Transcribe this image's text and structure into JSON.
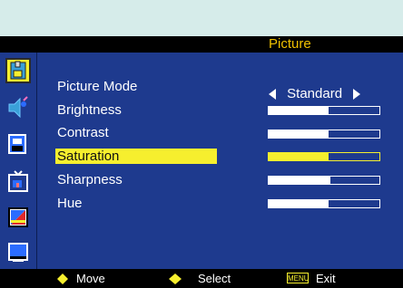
{
  "window": {
    "title": "Picture"
  },
  "menu": {
    "items": [
      {
        "label": "Picture Mode",
        "type": "selector",
        "value": "Standard"
      },
      {
        "label": "Brightness",
        "type": "slider",
        "level": 0.54
      },
      {
        "label": "Contrast",
        "type": "slider",
        "level": 0.54
      },
      {
        "label": "Saturation",
        "type": "slider",
        "level": 0.54,
        "selected": true
      },
      {
        "label": "Sharpness",
        "type": "slider",
        "level": 0.56
      },
      {
        "label": "Hue",
        "type": "slider",
        "level": 0.54
      }
    ]
  },
  "sidebar": {
    "icons": [
      {
        "name": "picture-icon",
        "active": true
      },
      {
        "name": "audio-icon",
        "active": false
      },
      {
        "name": "screen-icon",
        "active": false
      },
      {
        "name": "tv-icon",
        "active": false
      },
      {
        "name": "color-icon",
        "active": false
      },
      {
        "name": "monitor-icon",
        "active": false
      }
    ]
  },
  "footer": {
    "move_label": "Move",
    "select_label": "Select",
    "menu_badge": "MENU",
    "exit_label": "Exit"
  },
  "colors": {
    "background": "#1e3a8e",
    "highlight": "#f6ef2e",
    "title_text": "#f0c000"
  }
}
